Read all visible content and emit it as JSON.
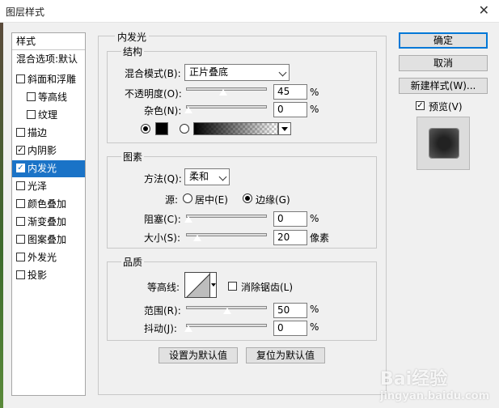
{
  "window": {
    "title": "图层样式",
    "close_glyph": "✕"
  },
  "style_list": {
    "header": "样式",
    "blend_options": "混合选项:默认",
    "items": [
      {
        "label": "斜面和浮雕",
        "checked": false
      },
      {
        "label": "等高线",
        "checked": false
      },
      {
        "label": "纹理",
        "checked": false
      },
      {
        "label": "描边",
        "checked": false
      },
      {
        "label": "内阴影",
        "checked": true
      },
      {
        "label": "内发光",
        "checked": true,
        "selected": true
      },
      {
        "label": "光泽",
        "checked": false
      },
      {
        "label": "颜色叠加",
        "checked": false
      },
      {
        "label": "渐变叠加",
        "checked": false
      },
      {
        "label": "图案叠加",
        "checked": false
      },
      {
        "label": "外发光",
        "checked": false
      },
      {
        "label": "投影",
        "checked": false
      }
    ]
  },
  "panel": {
    "title": "内发光",
    "structure": {
      "title": "结构",
      "blend_mode_label": "混合模式(B):",
      "blend_mode_value": "正片叠底",
      "opacity_label": "不透明度(O):",
      "opacity_value": "45",
      "noise_label": "杂色(N):",
      "noise_value": "0",
      "percent": "%",
      "color_swatch": "#000000",
      "color_mode": "color"
    },
    "elements": {
      "title": "图素",
      "method_label": "方法(Q):",
      "method_value": "柔和",
      "source_label": "源:",
      "source_center": "居中(E)",
      "source_edge": "边缘(G)",
      "source_selected": "edge",
      "choke_label": "阻塞(C):",
      "choke_value": "0",
      "size_label": "大小(S):",
      "size_value": "20",
      "size_unit": "像素",
      "percent": "%"
    },
    "quality": {
      "title": "品质",
      "contour_label": "等高线:",
      "anti_alias_label": "消除锯齿(L)",
      "anti_alias_checked": false,
      "range_label": "范围(R):",
      "range_value": "50",
      "jitter_label": "抖动(J):",
      "jitter_value": "0",
      "percent": "%"
    },
    "make_default": "设置为默认值",
    "reset_default": "复位为默认值"
  },
  "buttons": {
    "ok": "确定",
    "cancel": "取消",
    "new_style": "新建样式(W)...",
    "preview_label": "预览(V)",
    "preview_checked": true
  },
  "watermark": {
    "text": "Bai",
    "text2": "经验",
    "sub": "jingyan.baidu.com"
  },
  "colors": {
    "selection": "#1a73c7",
    "default_button_border": "#0078d7"
  }
}
